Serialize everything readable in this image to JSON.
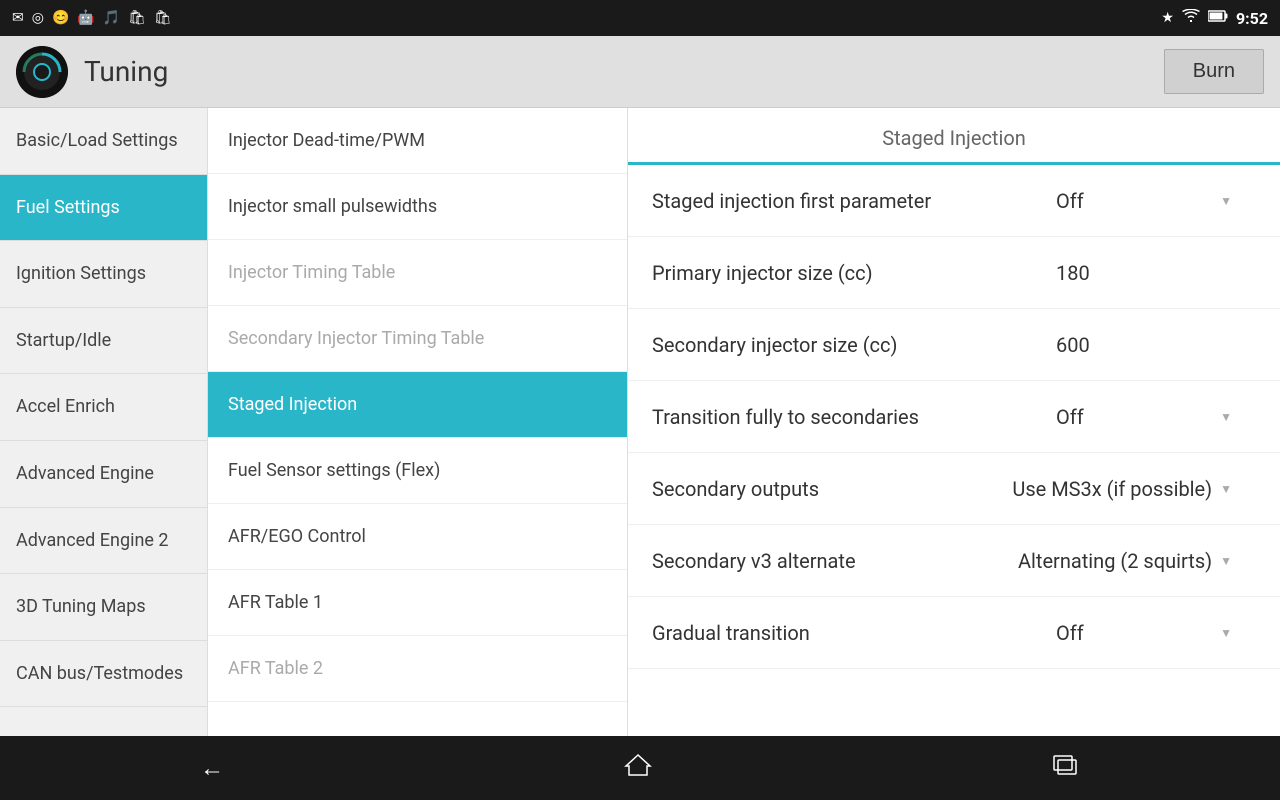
{
  "statusBar": {
    "time": "9:52",
    "leftIcons": [
      "✉",
      "📍",
      "😊",
      "🤖",
      "🎵",
      "🛍",
      "🛍"
    ],
    "rightIcons": [
      "bluetooth",
      "wifi",
      "battery"
    ]
  },
  "appBar": {
    "title": "Tuning",
    "burnLabel": "Burn"
  },
  "leftNav": {
    "items": [
      {
        "id": "basic-load",
        "label": "Basic/Load Settings",
        "active": false
      },
      {
        "id": "fuel-settings",
        "label": "Fuel Settings",
        "active": true
      },
      {
        "id": "ignition-settings",
        "label": "Ignition Settings",
        "active": false
      },
      {
        "id": "startup-idle",
        "label": "Startup/Idle",
        "active": false
      },
      {
        "id": "accel-enrich",
        "label": "Accel Enrich",
        "active": false
      },
      {
        "id": "advanced-engine",
        "label": "Advanced Engine",
        "active": false
      },
      {
        "id": "advanced-engine-2",
        "label": "Advanced Engine 2",
        "active": false
      },
      {
        "id": "3d-tuning",
        "label": "3D Tuning Maps",
        "active": false
      },
      {
        "id": "can-bus",
        "label": "CAN bus/Testmodes",
        "active": false
      }
    ]
  },
  "middlePanel": {
    "items": [
      {
        "id": "injector-deadtime",
        "label": "Injector Dead-time/PWM",
        "active": false,
        "dimmed": false
      },
      {
        "id": "injector-small",
        "label": "Injector small pulsewidths",
        "active": false,
        "dimmed": false
      },
      {
        "id": "injector-timing",
        "label": "Injector Timing Table",
        "active": false,
        "dimmed": true
      },
      {
        "id": "secondary-injector-timing",
        "label": "Secondary Injector Timing Table",
        "active": false,
        "dimmed": true
      },
      {
        "id": "staged-injection",
        "label": "Staged Injection",
        "active": true,
        "dimmed": false
      },
      {
        "id": "fuel-sensor",
        "label": "Fuel Sensor settings (Flex)",
        "active": false,
        "dimmed": false
      },
      {
        "id": "afr-ego",
        "label": "AFR/EGO Control",
        "active": false,
        "dimmed": false
      },
      {
        "id": "afr-table-1",
        "label": "AFR Table 1",
        "active": false,
        "dimmed": false
      },
      {
        "id": "afr-table-2",
        "label": "AFR Table 2",
        "active": false,
        "dimmed": true
      }
    ]
  },
  "rightPanel": {
    "title": "Staged Injection",
    "settings": [
      {
        "id": "staged-first-param",
        "label": "Staged injection first parameter",
        "value": "Off",
        "hasArrow": true
      },
      {
        "id": "primary-injector-size",
        "label": "Primary injector size (cc)",
        "value": "180",
        "hasArrow": false
      },
      {
        "id": "secondary-injector-size",
        "label": "Secondary injector size (cc)",
        "value": "600",
        "hasArrow": false
      },
      {
        "id": "transition-fully",
        "label": "Transition fully to secondaries",
        "value": "Off",
        "hasArrow": true
      },
      {
        "id": "secondary-outputs",
        "label": "Secondary outputs",
        "value": "Use MS3x (if possible)",
        "hasArrow": true
      },
      {
        "id": "secondary-v3",
        "label": "Secondary v3 alternate",
        "value": "Alternating (2 squirts)",
        "hasArrow": true
      },
      {
        "id": "gradual-transition",
        "label": "Gradual transition",
        "value": "Off",
        "hasArrow": true
      }
    ]
  },
  "bottomNav": {
    "backLabel": "←",
    "homeLabel": "⌂",
    "recentLabel": "▭"
  }
}
